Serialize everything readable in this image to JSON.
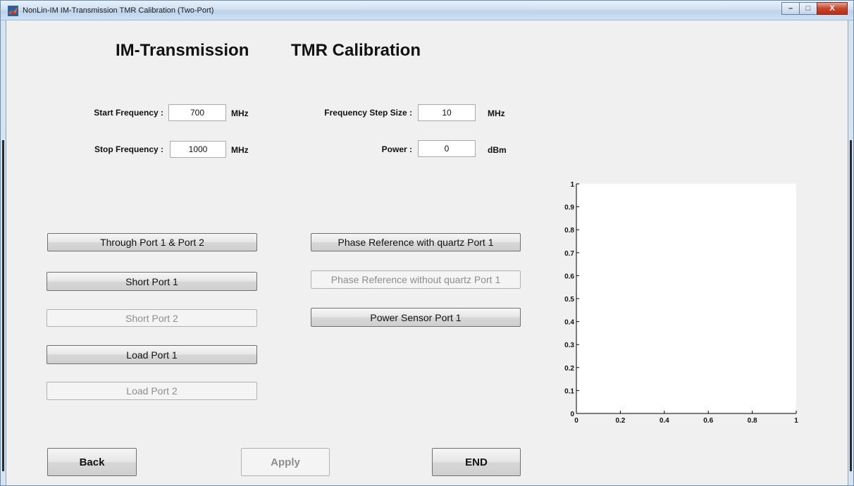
{
  "window": {
    "title": "NonLin-IM  IM-Transmission  TMR Calibration (Two-Port)",
    "controls": {
      "minimize": "–",
      "maximize": "□",
      "close": "X"
    }
  },
  "header": {
    "title_left": "IM-Transmission",
    "title_right": "TMR Calibration"
  },
  "form": {
    "start_frequency": {
      "label": "Start Frequency :",
      "value": "700",
      "unit": "MHz"
    },
    "stop_frequency": {
      "label": "Stop Frequency :",
      "value": "1000",
      "unit": "MHz"
    },
    "step_size": {
      "label": "Frequency Step Size :",
      "value": "10",
      "unit": "MHz"
    },
    "power": {
      "label": "Power :",
      "value": "0",
      "unit": "dBm"
    }
  },
  "buttons": {
    "through": "Through  Port 1 & Port 2",
    "short_port1": "Short  Port 1",
    "short_port2": "Short  Port 2",
    "load_port1": "Load  Port 1",
    "load_port2": "Load  Port 2",
    "phase_with_quartz": "Phase Reference with quartz  Port 1",
    "phase_without_quartz": "Phase Reference without quartz  Port 1",
    "power_sensor": "Power Sensor  Port 1",
    "back": "Back",
    "apply": "Apply",
    "end": "END"
  },
  "chart_data": {
    "type": "line",
    "series": [],
    "xlim": [
      0,
      1
    ],
    "ylim": [
      0,
      1
    ],
    "xticks": [
      "0",
      "0.2",
      "0.4",
      "0.6",
      "0.8",
      "1"
    ],
    "yticks": [
      "0",
      "0.1",
      "0.2",
      "0.3",
      "0.4",
      "0.5",
      "0.6",
      "0.7",
      "0.8",
      "0.9",
      "1"
    ],
    "grid": false
  },
  "colors": {
    "background": "#f0f0f0",
    "plot_background": "#ffffff"
  }
}
